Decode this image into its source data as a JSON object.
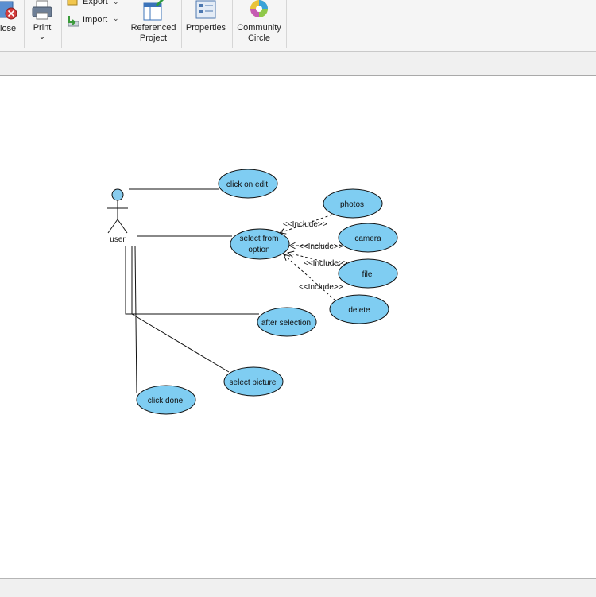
{
  "ribbon": {
    "close_label": "lose",
    "print_label": "Print",
    "export_label": "Export",
    "import_label": "Import",
    "referenced_project_line1": "Referenced",
    "referenced_project_line2": "Project",
    "properties_label": "Properties",
    "community_circle_line1": "Community",
    "community_circle_line2": "Circle"
  },
  "icons": {
    "close": "close-icon",
    "print": "printer-icon",
    "export": "export-icon",
    "import": "import-icon",
    "referenced_project": "referenced-project-icon",
    "properties": "properties-icon",
    "community_circle": "community-circle-icon",
    "dropdown": "chevron-down-icon"
  },
  "diagram": {
    "actor": {
      "name": "user"
    },
    "use_cases": {
      "click_on_edit": "click on edit",
      "select_from_option_line1": "select from",
      "select_from_option_line2": "option",
      "photos": "photos",
      "camera": "camera",
      "file": "file",
      "delete": "delete",
      "after_selection": "after selection",
      "select_picture": "select picture",
      "click_done": "click done"
    },
    "relations": {
      "include_photos": "<<Include>>",
      "include_camera": "<<Include>>",
      "include_file": "<<Include>>",
      "include_delete": "<<Include>>"
    }
  },
  "colors": {
    "use_case_fill": "#7fcdf2",
    "actor_head_fill": "#88ccee",
    "ribbon_bg": "#f5f5f5",
    "line": "#111111"
  }
}
